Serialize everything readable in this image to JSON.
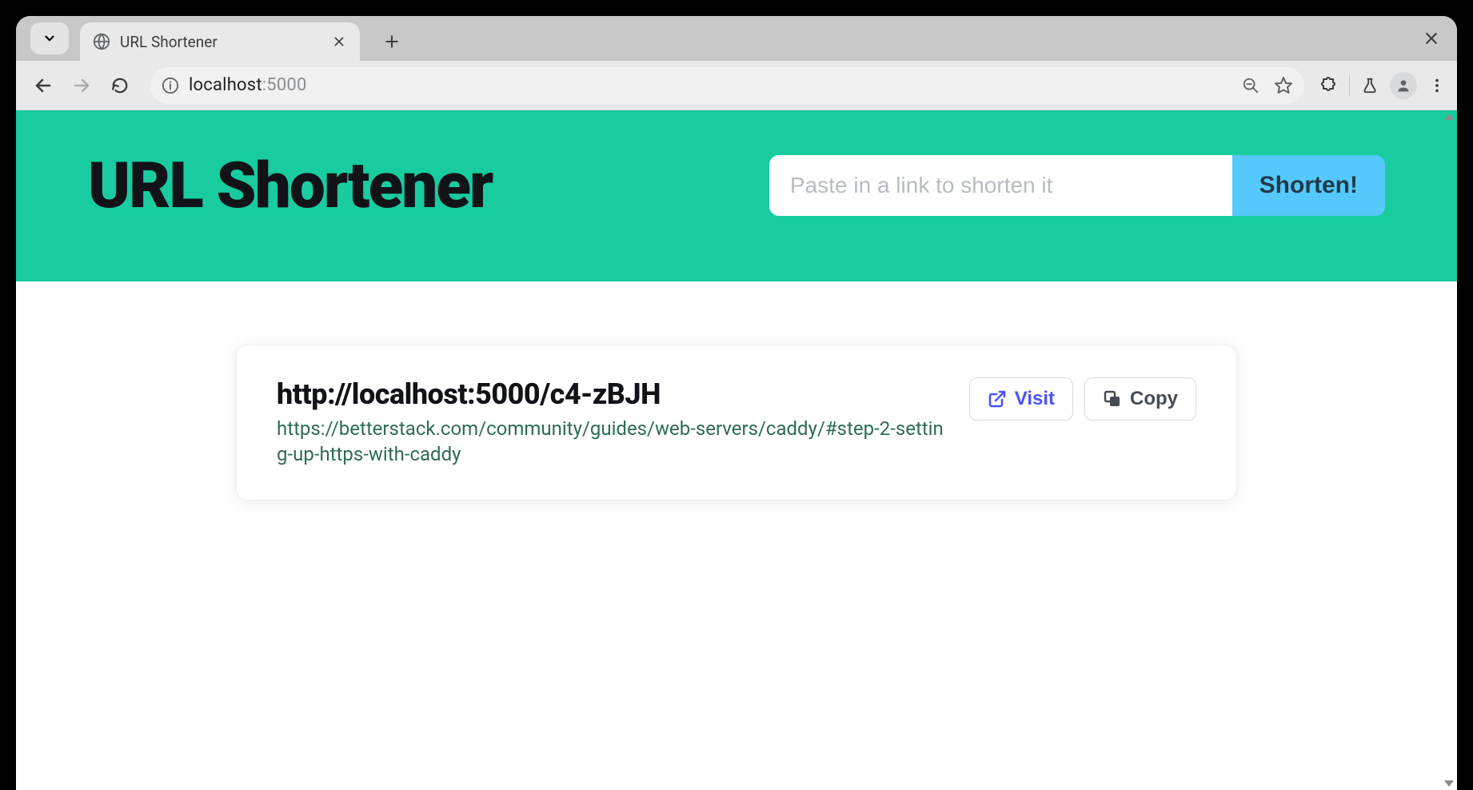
{
  "browser": {
    "tab_title": "URL Shortener",
    "url_host": "localhost",
    "url_rest": ":5000"
  },
  "hero": {
    "title": "URL Shortener",
    "input_placeholder": "Paste in a link to shorten it",
    "button_label": "Shorten!"
  },
  "result": {
    "short_url": "http://localhost:5000/c4-zBJH",
    "original_url": "https://betterstack.com/community/guides/web-servers/caddy/#step-2-setting-up-https-with-caddy",
    "visit_label": "Visit",
    "copy_label": "Copy"
  }
}
